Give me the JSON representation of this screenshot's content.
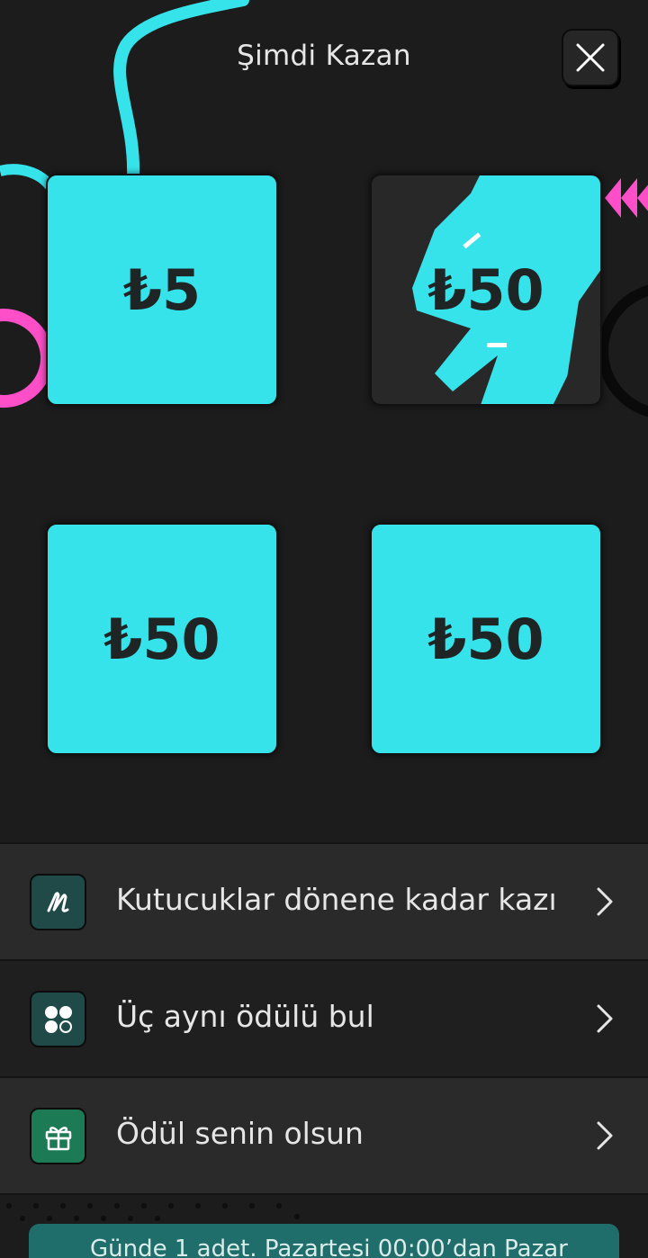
{
  "header": {
    "title": "Şimdi Kazan",
    "close_icon": "close-icon"
  },
  "cards": [
    {
      "prize": "₺5",
      "scratched": false
    },
    {
      "prize": "₺50",
      "scratched": true
    },
    {
      "prize": "₺50",
      "scratched": false
    },
    {
      "prize": "₺50",
      "scratched": false
    }
  ],
  "steps": [
    {
      "label": "Kutucuklar dönene kadar kazı",
      "icon": "scratch-icon",
      "icon_color": "#1f4a48"
    },
    {
      "label": "Üç aynı ödülü bul",
      "icon": "circles-icon",
      "icon_color": "#1f4a48"
    },
    {
      "label": "Ödül senin olsun",
      "icon": "gift-icon",
      "icon_color": "#1c7a55"
    }
  ],
  "footer": {
    "notice": "Günde 1 adet. Pazartesi 00:00’dan Pazar"
  },
  "colors": {
    "accent": "#36e3ea",
    "pink": "#ff4fc8",
    "background": "#1c1c1c"
  }
}
